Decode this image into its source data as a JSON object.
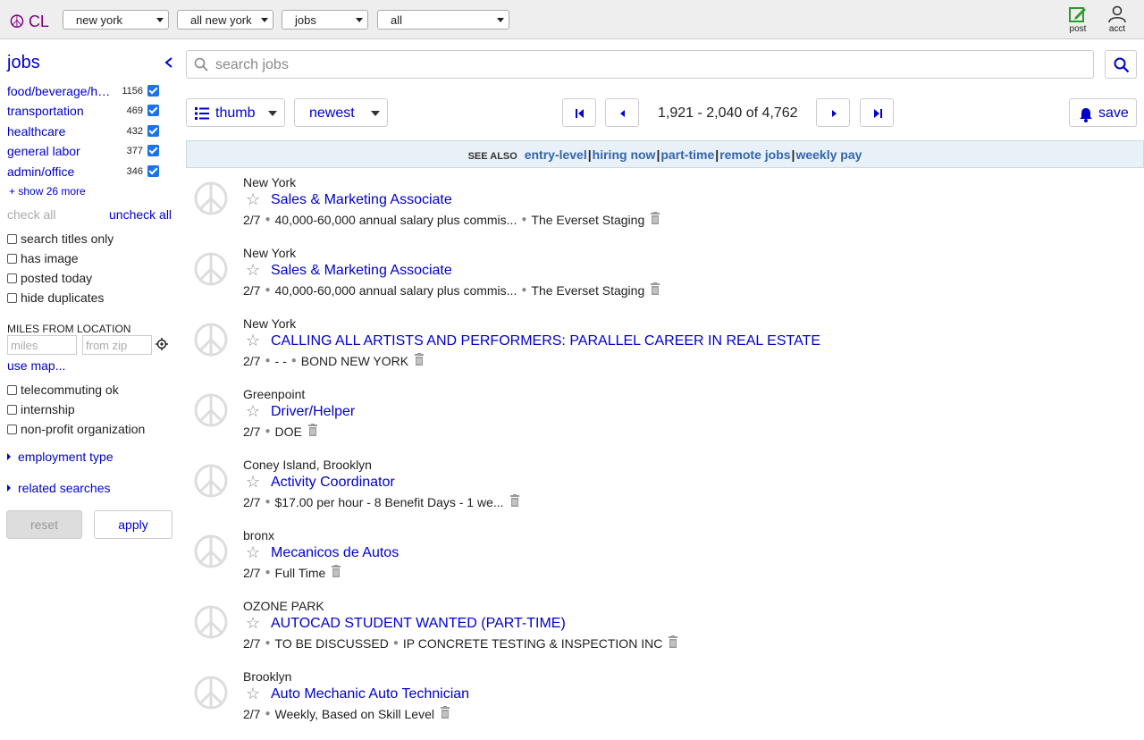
{
  "header": {
    "logo_text": "CL",
    "selects": [
      {
        "value": "new york"
      },
      {
        "value": "all new york"
      },
      {
        "value": "jobs"
      },
      {
        "value": "all"
      }
    ],
    "post_label": "post",
    "acct_label": "acct"
  },
  "sidebar": {
    "title": "jobs",
    "categories": [
      {
        "name": "food/beverage/hospitality",
        "count": "1156"
      },
      {
        "name": "transportation",
        "count": "469"
      },
      {
        "name": "healthcare",
        "count": "432"
      },
      {
        "name": "general labor",
        "count": "377"
      },
      {
        "name": "admin/office",
        "count": "346"
      }
    ],
    "show_more": "+ show 26 more",
    "check_all": "check all",
    "uncheck_all": "uncheck all",
    "options": [
      "search titles only",
      "has image",
      "posted today",
      "hide duplicates"
    ],
    "miles_label": "MILES FROM LOCATION",
    "miles_placeholder": "miles",
    "zip_placeholder": "from zip",
    "use_map": "use map...",
    "options2": [
      "telecommuting ok",
      "internship",
      "non-profit organization"
    ],
    "employment_type": "employment type",
    "related_searches": "related searches",
    "reset": "reset",
    "apply": "apply"
  },
  "main": {
    "search_placeholder": "search jobs",
    "view_mode": "thumb",
    "sort": "newest",
    "page_count": "1,921 - 2,040 of 4,762",
    "save": "save",
    "see_also_label": "SEE ALSO",
    "see_also": [
      "entry-level",
      "hiring now",
      "part-time",
      "remote jobs",
      "weekly pay"
    ],
    "listings": [
      {
        "location": "New York",
        "title": "Sales & Marketing Associate",
        "date": "2/7",
        "details": [
          "40,000-60,000 annual salary plus commis...",
          "The Everset Staging"
        ]
      },
      {
        "location": "New York",
        "title": "Sales & Marketing Associate",
        "date": "2/7",
        "details": [
          "40,000-60,000 annual salary plus commis...",
          "The Everset Staging"
        ]
      },
      {
        "location": "New York",
        "title": "CALLING ALL ARTISTS AND PERFORMERS: PARALLEL CAREER IN REAL ESTATE",
        "date": "2/7",
        "details": [
          "- -",
          "BOND NEW YORK"
        ]
      },
      {
        "location": "Greenpoint",
        "title": "Driver/Helper",
        "date": "2/7",
        "details": [
          "DOE"
        ]
      },
      {
        "location": "Coney Island, Brooklyn",
        "title": "Activity Coordinator",
        "date": "2/7",
        "details": [
          "$17.00 per hour - 8 Benefit Days - 1 we..."
        ]
      },
      {
        "location": "bronx",
        "title": "Mecanicos de Autos",
        "date": "2/7",
        "details": [
          "Full Time"
        ]
      },
      {
        "location": "OZONE PARK",
        "title": "AUTOCAD STUDENT WANTED (PART-TIME)",
        "date": "2/7",
        "details": [
          "TO BE DISCUSSED",
          "IP CONCRETE TESTING & INSPECTION INC"
        ]
      },
      {
        "location": "Brooklyn",
        "title": "Auto Mechanic Auto Technician",
        "date": "2/7",
        "details": [
          "Weekly, Based on Skill Level"
        ]
      }
    ]
  }
}
